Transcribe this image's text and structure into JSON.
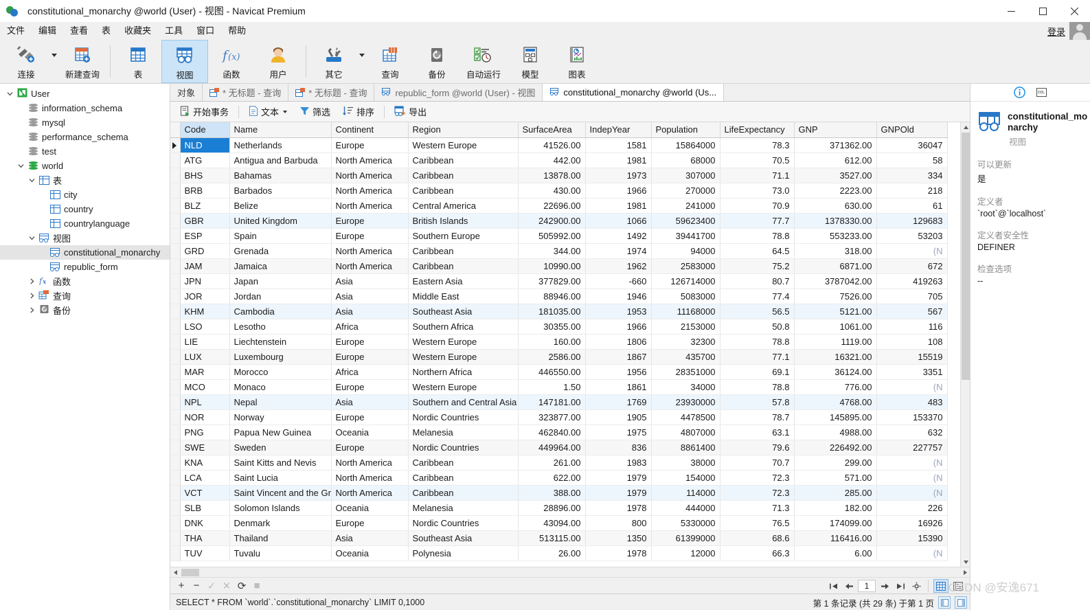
{
  "window": {
    "title": "constitutional_monarchy @world (User) - 视图 - Navicat Premium",
    "minimize": "−",
    "maximize": "☐",
    "close": "✕"
  },
  "menubar": {
    "items": [
      "文件",
      "编辑",
      "查看",
      "表",
      "收藏夹",
      "工具",
      "窗口",
      "帮助"
    ],
    "login_label": "登录"
  },
  "ribbon": {
    "items": [
      {
        "label": "连接",
        "icon": "connection-icon",
        "caret": true
      },
      {
        "label": "新建查询",
        "icon": "new-query-icon",
        "caret": false
      },
      {
        "label": "表",
        "icon": "table-icon",
        "caret": false
      },
      {
        "label": "视图",
        "icon": "view-icon",
        "caret": false,
        "selected": true
      },
      {
        "label": "函数",
        "icon": "function-icon",
        "caret": false
      },
      {
        "label": "用户",
        "icon": "user-icon",
        "caret": false
      },
      {
        "label": "其它",
        "icon": "other-tools-icon",
        "caret": true
      },
      {
        "label": "查询",
        "icon": "query-icon",
        "caret": false
      },
      {
        "label": "备份",
        "icon": "backup-icon",
        "caret": false
      },
      {
        "label": "自动运行",
        "icon": "automation-icon",
        "caret": false
      },
      {
        "label": "模型",
        "icon": "model-icon",
        "caret": false
      },
      {
        "label": "图表",
        "icon": "chart-icon",
        "caret": false
      }
    ]
  },
  "sidebar": {
    "nodes": [
      {
        "label": "User",
        "icon": "navicat-connection-icon",
        "indent": 0,
        "twisty": "down"
      },
      {
        "label": "information_schema",
        "icon": "database-icon",
        "indent": 1,
        "twisty": ""
      },
      {
        "label": "mysql",
        "icon": "database-icon",
        "indent": 1,
        "twisty": ""
      },
      {
        "label": "performance_schema",
        "icon": "database-icon",
        "indent": 1,
        "twisty": ""
      },
      {
        "label": "test",
        "icon": "database-icon",
        "indent": 1,
        "twisty": ""
      },
      {
        "label": "world",
        "icon": "database-open-icon",
        "indent": 1,
        "twisty": "down"
      },
      {
        "label": "表",
        "icon": "table-icon",
        "indent": 2,
        "twisty": "down"
      },
      {
        "label": "city",
        "icon": "table-icon",
        "indent": 3,
        "twisty": ""
      },
      {
        "label": "country",
        "icon": "table-icon",
        "indent": 3,
        "twisty": ""
      },
      {
        "label": "countrylanguage",
        "icon": "table-icon",
        "indent": 3,
        "twisty": ""
      },
      {
        "label": "视图",
        "icon": "view-icon",
        "indent": 2,
        "twisty": "down"
      },
      {
        "label": "constitutional_monarchy",
        "icon": "view-icon",
        "indent": 3,
        "twisty": "",
        "selected": true
      },
      {
        "label": "republic_form",
        "icon": "view-icon",
        "indent": 3,
        "twisty": ""
      },
      {
        "label": "函数",
        "icon": "function-icon",
        "indent": 2,
        "twisty": "right"
      },
      {
        "label": "查询",
        "icon": "query-icon",
        "indent": 2,
        "twisty": "right"
      },
      {
        "label": "备份",
        "icon": "backup-icon",
        "indent": 2,
        "twisty": "right"
      }
    ]
  },
  "tabs": [
    {
      "label": "对象",
      "icon": "",
      "active": false
    },
    {
      "label": "* 无标题 - 查询",
      "icon": "query-icon",
      "active": false
    },
    {
      "label": "* 无标题 - 查询",
      "icon": "query-icon",
      "active": false
    },
    {
      "label": "republic_form @world (User) - 视图",
      "icon": "view-icon",
      "active": false
    },
    {
      "label": "constitutional_monarchy @world (Us...",
      "icon": "view-icon",
      "active": true
    }
  ],
  "subtoolbar": [
    {
      "label": "开始事务",
      "icon": "transaction-icon",
      "caret": false
    },
    {
      "label": "文本",
      "icon": "text-icon",
      "caret": true
    },
    {
      "label": "筛选",
      "icon": "filter-icon",
      "caret": false
    },
    {
      "label": "排序",
      "icon": "sort-icon",
      "caret": false
    },
    {
      "label": "导出",
      "icon": "export-icon",
      "caret": false
    }
  ],
  "grid": {
    "columns": [
      "Code",
      "Name",
      "Continent",
      "Region",
      "SurfaceArea",
      "IndepYear",
      "Population",
      "LifeExpectancy",
      "GNP",
      "GNPOld"
    ],
    "selected_column": "Code",
    "selected_row_index": 0,
    "null_text": "(N",
    "rows": [
      [
        "NLD",
        "Netherlands",
        "Europe",
        "Western Europe",
        "41526.00",
        "1581",
        "15864000",
        "78.3",
        "371362.00",
        "36047"
      ],
      [
        "ATG",
        "Antigua and Barbuda",
        "North America",
        "Caribbean",
        "442.00",
        "1981",
        "68000",
        "70.5",
        "612.00",
        "58"
      ],
      [
        "BHS",
        "Bahamas",
        "North America",
        "Caribbean",
        "13878.00",
        "1973",
        "307000",
        "71.1",
        "3527.00",
        "334"
      ],
      [
        "BRB",
        "Barbados",
        "North America",
        "Caribbean",
        "430.00",
        "1966",
        "270000",
        "73.0",
        "2223.00",
        "218"
      ],
      [
        "BLZ",
        "Belize",
        "North America",
        "Central America",
        "22696.00",
        "1981",
        "241000",
        "70.9",
        "630.00",
        "61"
      ],
      [
        "GBR",
        "United Kingdom",
        "Europe",
        "British Islands",
        "242900.00",
        "1066",
        "59623400",
        "77.7",
        "1378330.00",
        "129683"
      ],
      [
        "ESP",
        "Spain",
        "Europe",
        "Southern Europe",
        "505992.00",
        "1492",
        "39441700",
        "78.8",
        "553233.00",
        "53203"
      ],
      [
        "GRD",
        "Grenada",
        "North America",
        "Caribbean",
        "344.00",
        "1974",
        "94000",
        "64.5",
        "318.00",
        "(N"
      ],
      [
        "JAM",
        "Jamaica",
        "North America",
        "Caribbean",
        "10990.00",
        "1962",
        "2583000",
        "75.2",
        "6871.00",
        "672"
      ],
      [
        "JPN",
        "Japan",
        "Asia",
        "Eastern Asia",
        "377829.00",
        "-660",
        "126714000",
        "80.7",
        "3787042.00",
        "419263"
      ],
      [
        "JOR",
        "Jordan",
        "Asia",
        "Middle East",
        "88946.00",
        "1946",
        "5083000",
        "77.4",
        "7526.00",
        "705"
      ],
      [
        "KHM",
        "Cambodia",
        "Asia",
        "Southeast Asia",
        "181035.00",
        "1953",
        "11168000",
        "56.5",
        "5121.00",
        "567"
      ],
      [
        "LSO",
        "Lesotho",
        "Africa",
        "Southern Africa",
        "30355.00",
        "1966",
        "2153000",
        "50.8",
        "1061.00",
        "116"
      ],
      [
        "LIE",
        "Liechtenstein",
        "Europe",
        "Western Europe",
        "160.00",
        "1806",
        "32300",
        "78.8",
        "1119.00",
        "108"
      ],
      [
        "LUX",
        "Luxembourg",
        "Europe",
        "Western Europe",
        "2586.00",
        "1867",
        "435700",
        "77.1",
        "16321.00",
        "15519"
      ],
      [
        "MAR",
        "Morocco",
        "Africa",
        "Northern Africa",
        "446550.00",
        "1956",
        "28351000",
        "69.1",
        "36124.00",
        "3351"
      ],
      [
        "MCO",
        "Monaco",
        "Europe",
        "Western Europe",
        "1.50",
        "1861",
        "34000",
        "78.8",
        "776.00",
        "(N"
      ],
      [
        "NPL",
        "Nepal",
        "Asia",
        "Southern and Central Asia",
        "147181.00",
        "1769",
        "23930000",
        "57.8",
        "4768.00",
        "483"
      ],
      [
        "NOR",
        "Norway",
        "Europe",
        "Nordic Countries",
        "323877.00",
        "1905",
        "4478500",
        "78.7",
        "145895.00",
        "153370"
      ],
      [
        "PNG",
        "Papua New Guinea",
        "Oceania",
        "Melanesia",
        "462840.00",
        "1975",
        "4807000",
        "63.1",
        "4988.00",
        "632"
      ],
      [
        "SWE",
        "Sweden",
        "Europe",
        "Nordic Countries",
        "449964.00",
        "836",
        "8861400",
        "79.6",
        "226492.00",
        "227757"
      ],
      [
        "KNA",
        "Saint Kitts and Nevis",
        "North America",
        "Caribbean",
        "261.00",
        "1983",
        "38000",
        "70.7",
        "299.00",
        "(N"
      ],
      [
        "LCA",
        "Saint Lucia",
        "North America",
        "Caribbean",
        "622.00",
        "1979",
        "154000",
        "72.3",
        "571.00",
        "(N"
      ],
      [
        "VCT",
        "Saint Vincent and the Gre",
        "North America",
        "Caribbean",
        "388.00",
        "1979",
        "114000",
        "72.3",
        "285.00",
        "(N"
      ],
      [
        "SLB",
        "Solomon Islands",
        "Oceania",
        "Melanesia",
        "28896.00",
        "1978",
        "444000",
        "71.3",
        "182.00",
        "226"
      ],
      [
        "DNK",
        "Denmark",
        "Europe",
        "Nordic Countries",
        "43094.00",
        "800",
        "5330000",
        "76.5",
        "174099.00",
        "16926"
      ],
      [
        "THA",
        "Thailand",
        "Asia",
        "Southeast Asia",
        "513115.00",
        "1350",
        "61399000",
        "68.6",
        "116416.00",
        "15390"
      ],
      [
        "TUV",
        "Tuvalu",
        "Oceania",
        "Polynesia",
        "26.00",
        "1978",
        "12000",
        "66.3",
        "6.00",
        "(N"
      ]
    ]
  },
  "recordbar": {
    "add": "+",
    "remove": "−",
    "confirm": "✓",
    "cancel": "✕",
    "refresh": "⟳",
    "stop": "■",
    "page_value": "1",
    "first": "first-page",
    "prev": "prev-page",
    "next": "next-page",
    "last": "last-page",
    "settings": "gear"
  },
  "statusbar": {
    "sql": "SELECT * FROM `world`.`constitutional_monarchy` LIMIT 0,1000",
    "record_info": "第 1 条记录 (共 29 条) 于第 1 页"
  },
  "infopanel": {
    "header_icons": [
      "info-icon",
      "ddl-icon"
    ],
    "name": "constitutional_monarchy",
    "type": "视图",
    "fields": [
      {
        "label": "可以更新",
        "value": "是"
      },
      {
        "label": "定义者",
        "value": "`root`@`localhost`"
      },
      {
        "label": "定义者安全性",
        "value": "DEFINER"
      },
      {
        "label": "检查选项",
        "value": "--"
      }
    ]
  },
  "watermark": "CSDN @安逸671"
}
